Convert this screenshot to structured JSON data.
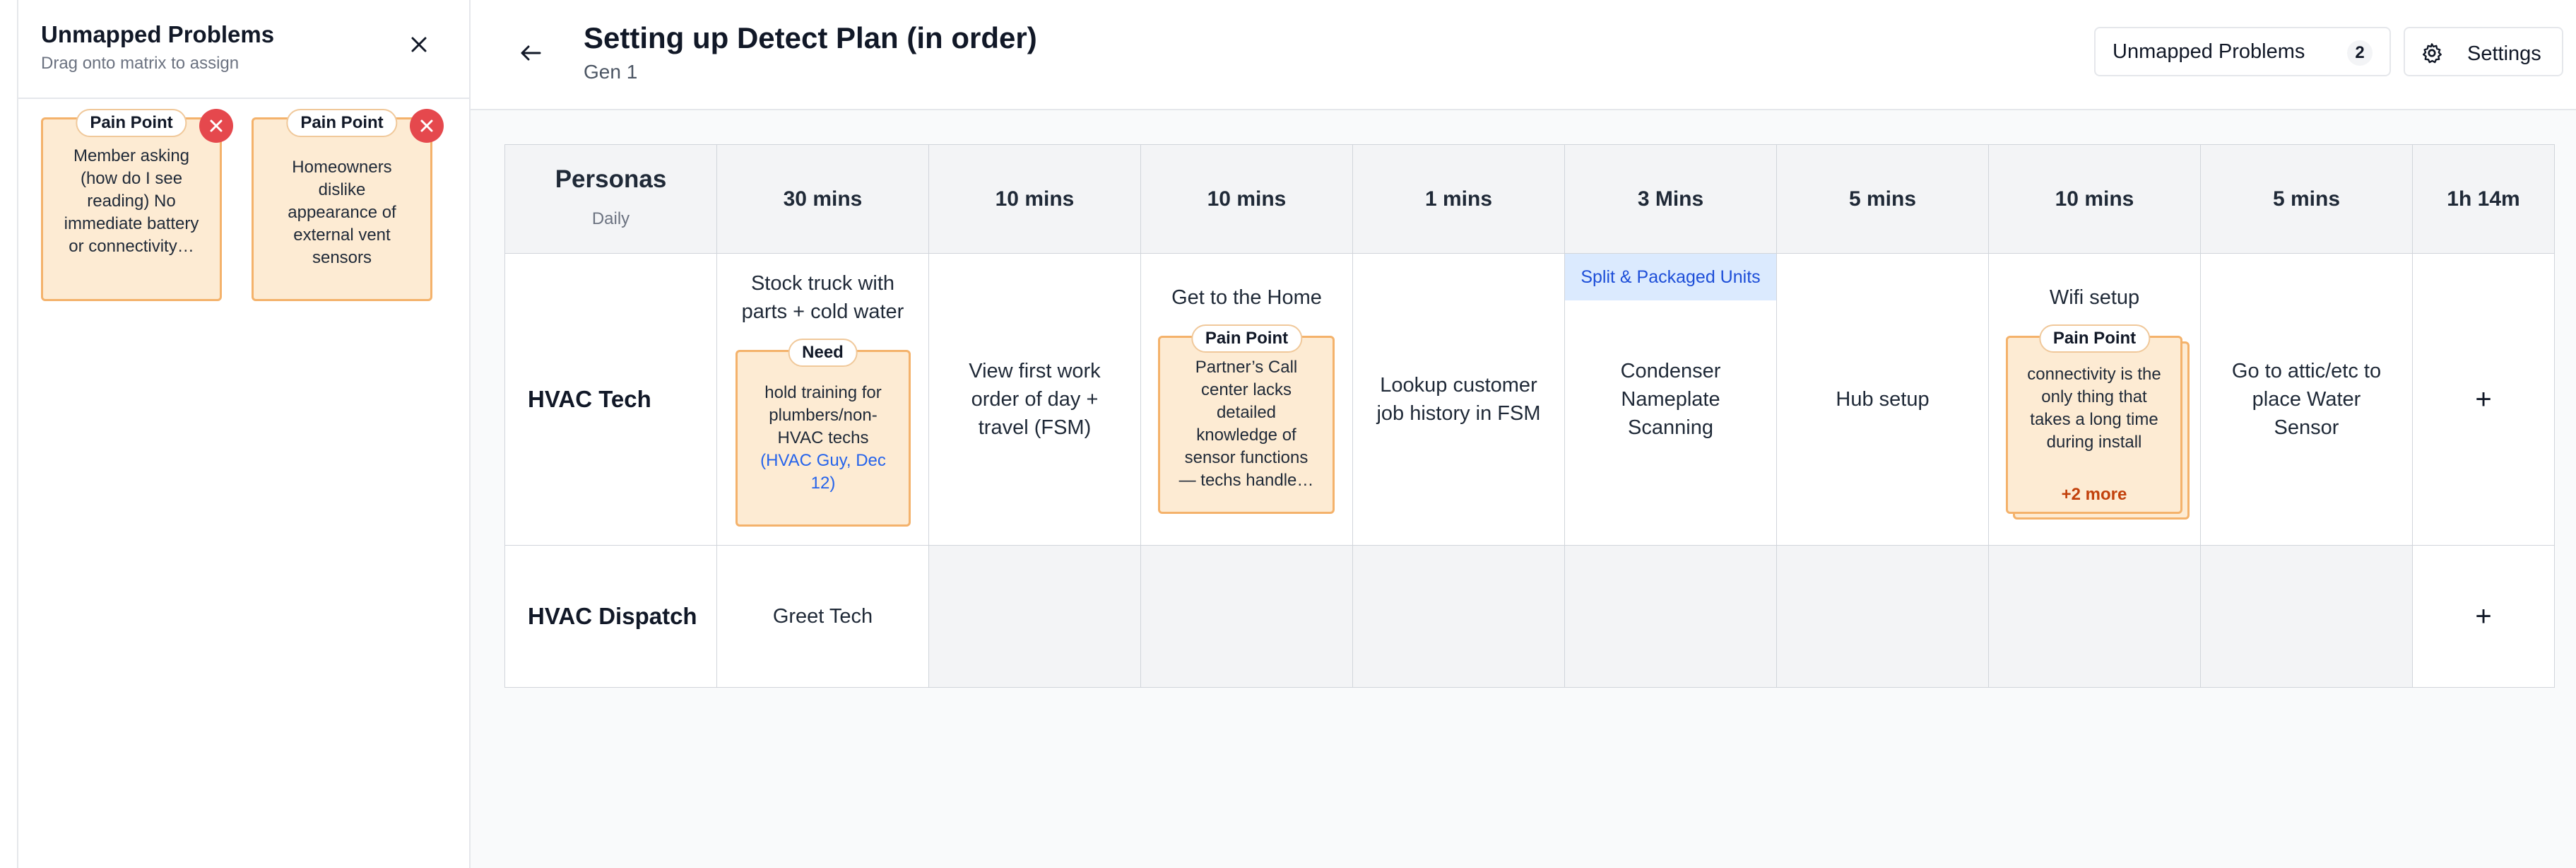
{
  "left_panel": {
    "title": "Unmapped Problems",
    "subtitle": "Drag onto matrix to assign",
    "cards": [
      {
        "tag": "Pain Point",
        "text": "Member asking (how do I see reading) No immediate battery or connectivity…"
      },
      {
        "tag": "Pain Point",
        "text": "Homeowners dislike appearance of external vent sensors"
      }
    ]
  },
  "header": {
    "title": "Setting up Detect Plan (in order)",
    "subtitle": "Gen 1",
    "unmapped_label": "Unmapped Problems",
    "unmapped_count": "2",
    "settings_label": "Settings"
  },
  "matrix": {
    "personas_title": "Personas",
    "personas_sub": "Daily",
    "durations": [
      "30 mins",
      "10 mins",
      "10 mins",
      "1 mins",
      "3 Mins",
      "5 mins",
      "10 mins",
      "5 mins",
      "1h 14m"
    ],
    "rows": [
      {
        "persona": "HVAC Tech",
        "steps": [
          "Stock truck with parts + cold water",
          "View first work order of day + travel (FSM)",
          "Get to the Home",
          "Lookup customer job history in FSM",
          "Condenser Nameplate Scanning",
          "Hub setup",
          "Wifi setup",
          "Go to attic/etc to place Water Sensor"
        ],
        "add_label": "+"
      },
      {
        "persona": "HVAC Dispatch",
        "steps": [
          "Greet Tech"
        ],
        "add_label": "+"
      }
    ],
    "split_tag": "Split & Packaged Units",
    "need_card": {
      "tag": "Need",
      "text": "hold training for plumbers/non-HVAC techs",
      "source": "(HVAC Guy, Dec 12)"
    },
    "pain_card_home": {
      "tag": "Pain Point",
      "text": "Partner’s Call center lacks detailed knowledge of sensor functions — techs handle…"
    },
    "pain_card_wifi": {
      "tag": "Pain Point",
      "text": "connectivity is the only thing that takes a long time during install",
      "more": "+2 more"
    }
  },
  "colors": {
    "card_bg": "#fdebd3",
    "card_border": "#f4b26b",
    "delete_red": "#e5484d",
    "split_tag_bg": "#dbeafe",
    "link_blue": "#2563eb"
  }
}
